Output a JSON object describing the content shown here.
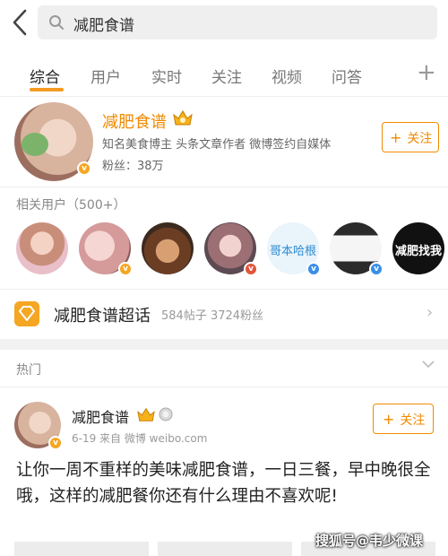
{
  "search": {
    "query": "减肥食谱"
  },
  "tabs": [
    {
      "label": "综合"
    },
    {
      "label": "用户"
    },
    {
      "label": "实时"
    },
    {
      "label": "关注"
    },
    {
      "label": "视频"
    },
    {
      "label": "问答"
    }
  ],
  "tab_add": "+",
  "profile": {
    "name": "减肥食谱",
    "desc": "知名美食博主 头条文章作者 微博签约自媒体",
    "fans": "粉丝：38万",
    "follow_label": "关注",
    "follow_plus": "+"
  },
  "related": {
    "title": "相关用户（500+）",
    "avatar2_text": "哥本哈根",
    "avatar3_text": "减肥找我"
  },
  "topic": {
    "name": "减肥食谱超话",
    "stats": "584帖子  3724粉丝",
    "chevron": "›"
  },
  "hot": {
    "label": "热门"
  },
  "post": {
    "name": "减肥食谱",
    "meta": "6-19  来自 微博 weibo.com",
    "follow_label": "关注",
    "follow_plus": "+",
    "text": "让你一周不重样的美味减肥食谱，一日三餐，早中晚很全哦，这样的减肥餐你还有什么理由不喜欢呢!"
  },
  "watermark": "搜狐号@韦少微课",
  "colors": {
    "accent": "#f08a00",
    "tab_underline": "#f59b22"
  }
}
